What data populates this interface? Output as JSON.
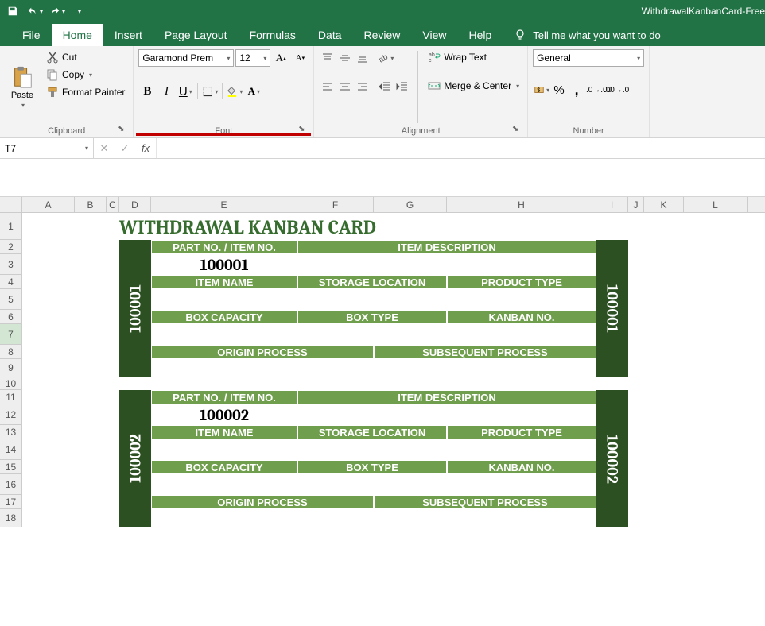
{
  "titlebar": {
    "filename": "WithdrawalKanbanCard-Free"
  },
  "tabs": {
    "file": "File",
    "home": "Home",
    "insert": "Insert",
    "pagelayout": "Page Layout",
    "formulas": "Formulas",
    "data": "Data",
    "review": "Review",
    "view": "View",
    "help": "Help",
    "tellme": "Tell me what you want to do"
  },
  "ribbon": {
    "clipboard": {
      "paste": "Paste",
      "cut": "Cut",
      "copy": "Copy",
      "format_painter": "Format Painter",
      "label": "Clipboard"
    },
    "font": {
      "name": "Garamond Prem",
      "size": "12",
      "bold": "B",
      "italic": "I",
      "underline": "U",
      "label": "Font"
    },
    "alignment": {
      "wrap": "Wrap Text",
      "merge": "Merge & Center",
      "label": "Alignment"
    },
    "number": {
      "format": "General",
      "percent": "%",
      "comma": ",",
      "label": "Number"
    }
  },
  "namebox": "T7",
  "columns": [
    "A",
    "B",
    "C",
    "D",
    "E",
    "F",
    "G",
    "H",
    "I",
    "J",
    "K",
    "L"
  ],
  "rows": [
    "1",
    "2",
    "3",
    "4",
    "5",
    "6",
    "7",
    "8",
    "9",
    "10",
    "11",
    "12",
    "13",
    "14",
    "15",
    "16",
    "17",
    "18"
  ],
  "doc": {
    "title": "WITHDRAWAL KANBAN CARD",
    "labels": {
      "part_no": "PART NO. / ITEM NO.",
      "item_desc": "ITEM DESCRIPTION",
      "item_name": "ITEM NAME",
      "storage": "STORAGE LOCATION",
      "product_type": "PRODUCT TYPE",
      "box_cap": "BOX CAPACITY",
      "box_type": "BOX TYPE",
      "kanban_no": "KANBAN NO.",
      "origin": "ORIGIN PROCESS",
      "subsequent": "SUBSEQUENT PROCESS"
    },
    "cards": [
      {
        "part_no": "100001",
        "side_left": "100001",
        "side_right": "100001"
      },
      {
        "part_no": "100002",
        "side_left": "100002",
        "side_right": "100002"
      }
    ]
  }
}
